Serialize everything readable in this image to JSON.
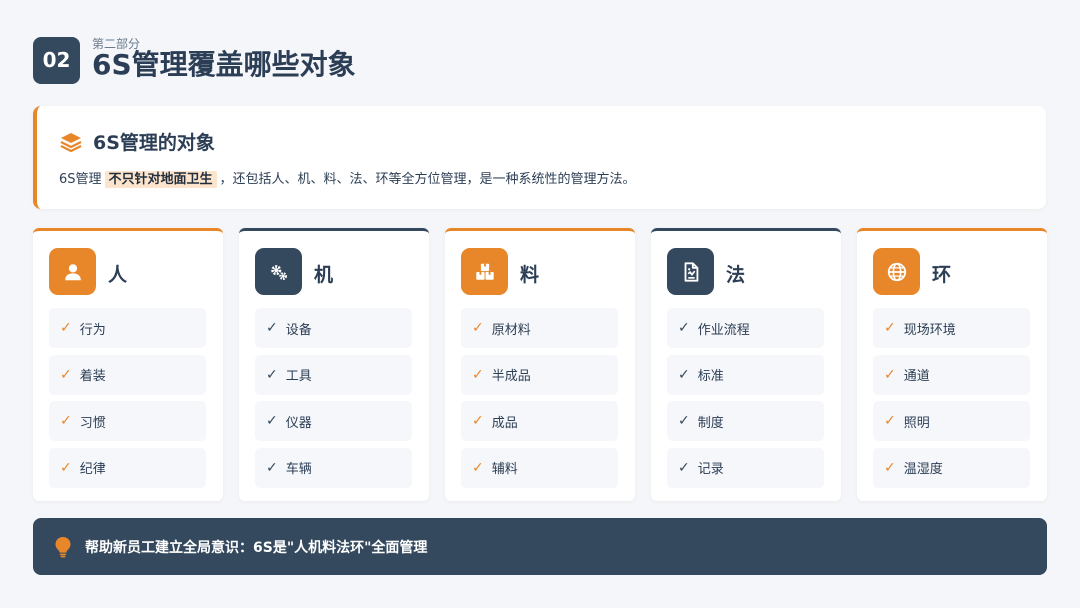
{
  "header": {
    "section_number": "02",
    "subtitle": "第二部分",
    "title": "6S管理覆盖哪些对象"
  },
  "intro": {
    "icon": "layers-icon",
    "title": "6S管理的对象",
    "text_before": "6S管理",
    "highlight": "不只针对地面卫生",
    "text_after": "，还包括人、机、料、法、环等全方位管理，是一种系统性的管理方法。"
  },
  "cards": [
    {
      "title": "人",
      "icon": "user-icon",
      "items": [
        "行为",
        "着装",
        "习惯",
        "纪律"
      ]
    },
    {
      "title": "机",
      "icon": "gears-icon",
      "items": [
        "设备",
        "工具",
        "仪器",
        "车辆"
      ]
    },
    {
      "title": "料",
      "icon": "boxes-icon",
      "items": [
        "原材料",
        "半成品",
        "成品",
        "辅料"
      ]
    },
    {
      "title": "法",
      "icon": "document-icon",
      "items": [
        "作业流程",
        "标准",
        "制度",
        "记录"
      ]
    },
    {
      "title": "环",
      "icon": "globe-icon",
      "items": [
        "现场环境",
        "通道",
        "照明",
        "温湿度"
      ]
    }
  ],
  "footer": {
    "icon": "lightbulb-icon",
    "text": "帮助新员工建立全局意识：6S是\"人机料法环\"全面管理"
  },
  "colors": {
    "accent": "#e8872a",
    "dark": "#34495e",
    "background": "#f4f6f9",
    "highlight_bg": "#fde4cc"
  }
}
